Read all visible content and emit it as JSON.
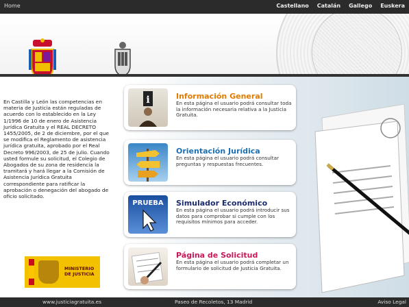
{
  "topbar": {
    "home": "Home",
    "languages": [
      "Castellano",
      "Catalán",
      "Gallego",
      "Euskera"
    ]
  },
  "intro_text": "En Castilla y León las competencias en materia de Justicia están reguladas de acuerdo con lo establecido en la Ley 1/1996 de 10 de enero de Asistencia Jurídica Gratuita y el REAL DECRETO 1455/2005, de 2 de diciembre, por el que se modifica el Reglamento de asistencia jurídica gratuita, aprobado por el Real Decreto 996/2003, de 25 de julio. Cuando usted formule su solicitud, el Colegio de Abogados de su zona de residencia la tramitará y hará llegar a la Comisión de Asistencia Jurídica Gratuita correspondiente para ratificar la aprobación o denegación del abogado de oficio solicitado.",
  "ministry_logo": {
    "line1": "MINISTERIO",
    "line2": "DE JUSTICIA"
  },
  "cards": [
    {
      "title": "Información General",
      "description": "En esta página el usuario podrá consultar toda la información necesaria relativa a la Justicia Gratuita.",
      "color": "#e07b00",
      "icon": "info-person-icon"
    },
    {
      "title": "Orientación Jurídica",
      "description": "En esta página el usuario podrá consultar preguntas y respuestas frecuentes.",
      "color": "#1a6fb5",
      "icon": "signpost-icon"
    },
    {
      "title": "Simulador Económico",
      "description": "En esta página el usuario podrá introducir sus datos para comprobar si cumple con los requisitos mínimos para acceder.",
      "color": "#1a2a6e",
      "icon": "prueba-cursor-icon",
      "thumb_label": "PRUEBA"
    },
    {
      "title": "Página de Solicitud",
      "description": "En esta página el usuario podrá completar un formulario de solicitud de Justicia Gratuita.",
      "color": "#c8185a",
      "icon": "form-pen-icon"
    }
  ],
  "footer": {
    "website": "www.justiciagratuita.es",
    "address": "Paseo de Recoletos, 13 Madrid",
    "legal": "Aviso Legal"
  }
}
